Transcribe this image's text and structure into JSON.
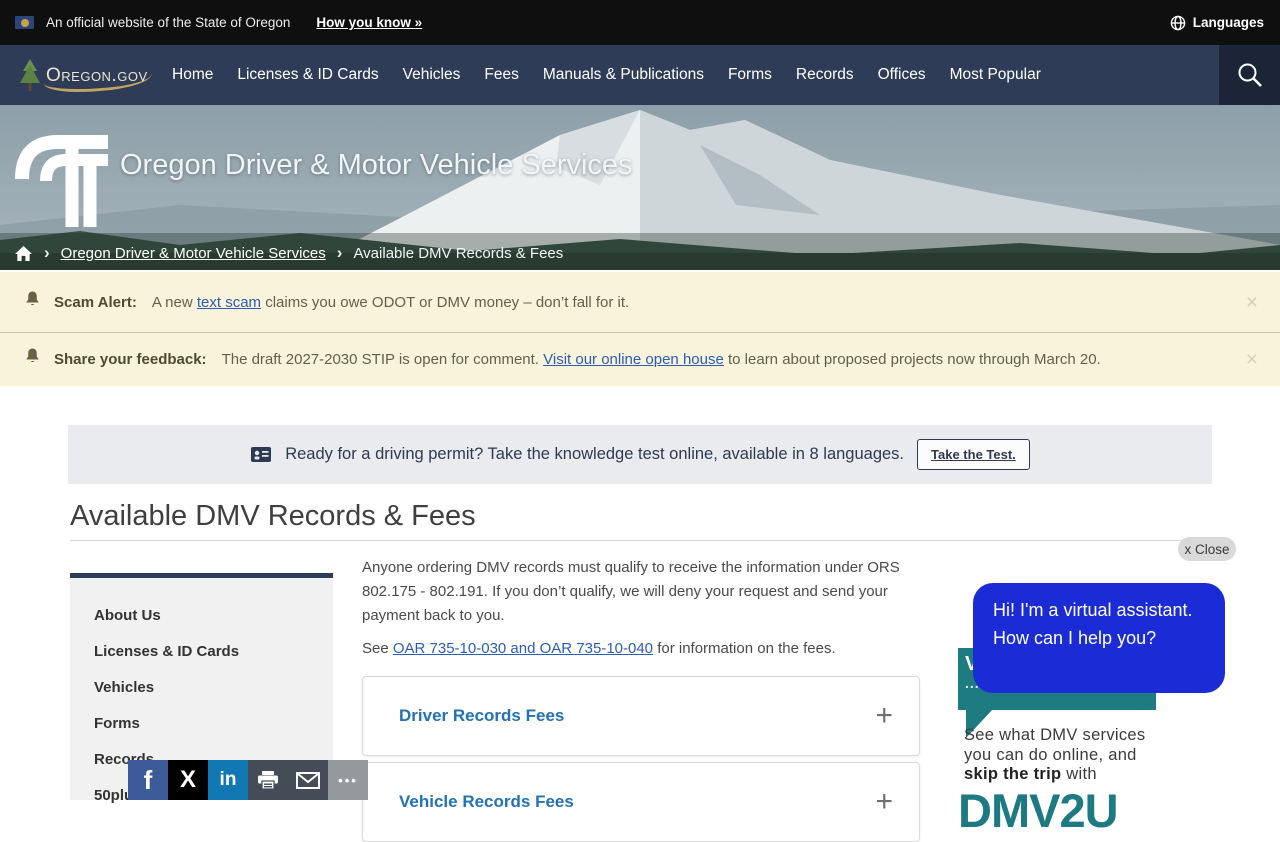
{
  "colors": {
    "topbar_black": "#0f0f0f",
    "nav_navy": "#2e3c57",
    "search_navy": "#1c2537",
    "alert_cream": "#f9f3dc",
    "alert_label_brown": "#4f4b33",
    "link_blue": "#2b5db5",
    "permit_gray": "#e9ebee",
    "permit_navy": "#2e3a52",
    "sidebar_gray": "#f1f1f1",
    "accordion_blue": "#2272b5",
    "assistant_blue": "#1b2bd6",
    "promo_teal": "#1e7b81",
    "brand_teal": "#1d7a82",
    "facebook_blue": "#3d5b99",
    "x_black": "#000000",
    "linkedin_blue": "#1178b3"
  },
  "official_bar": {
    "text": "An official website of the State of Oregon",
    "link": "How you know »",
    "languages": "Languages"
  },
  "nav": {
    "logo_text": "Oregon.gov",
    "items": [
      "Home",
      "Licenses & ID Cards",
      "Vehicles",
      "Fees",
      "Manuals & Publications",
      "Forms",
      "Records",
      "Offices",
      "Most Popular"
    ]
  },
  "hero": {
    "title": "Oregon Driver & Motor Vehicle Services"
  },
  "breadcrumb": {
    "separator": "›",
    "parent": "Oregon Driver & Motor Vehicle Services",
    "current": "Available DMV Records & Fees"
  },
  "alerts": [
    {
      "label": "Scam Alert:",
      "text_before": "A new ",
      "link_text": "text scam",
      "text_after": " claims you owe ODOT or DMV money – don’t fall for it.",
      "close_symbol": "×"
    },
    {
      "label": "Share your feedback:",
      "text_before": "The draft 2027-2030 STIP is open for comment. ",
      "link_text": "Visit our online open house",
      "text_after": " to learn about  proposed projects now through March 20.",
      "close_symbol": "×"
    }
  ],
  "permit_banner": {
    "text": "Ready for a driving permit? Take the knowledge test online, available in 8 languages.",
    "button_label": "Take the Test."
  },
  "page": {
    "title": "Available DMV Records & Fees"
  },
  "sidebar": {
    "items": [
      "About Us",
      "Licenses & ID Cards",
      "Vehicles",
      "Forms",
      "Records",
      "50plus"
    ]
  },
  "content": {
    "paragraph": "Anyone ordering DMV records must qualify to receive the information under ORS 802.175 - 802.191. If you don’t qualify, we will deny your request and send your payment back to you.",
    "see_before": "See ",
    "see_link": "OAR 735-10-030 and OAR 735-10-040",
    "see_after": " for information on the fees.",
    "expand_symbol": "+",
    "accordions": [
      {
        "title": "Driver Records Fees"
      },
      {
        "title": "Vehicle Records Fees"
      }
    ]
  },
  "assistant": {
    "close_label": "x Close",
    "message_line1": "Hi! I'm a virtual assistant.",
    "message_line2": "How can I help you?",
    "promo_partial_letter": "V",
    "promo_partial_dots": "...",
    "promo_line1": "See what DMV services",
    "promo_line2": "you can do online, and",
    "promo_bold": "skip the trip",
    "promo_line3_rest": " with",
    "brand": "DMV2U"
  },
  "share": {
    "facebook": "f",
    "x": "X",
    "linkedin": "in",
    "more": "•••"
  }
}
